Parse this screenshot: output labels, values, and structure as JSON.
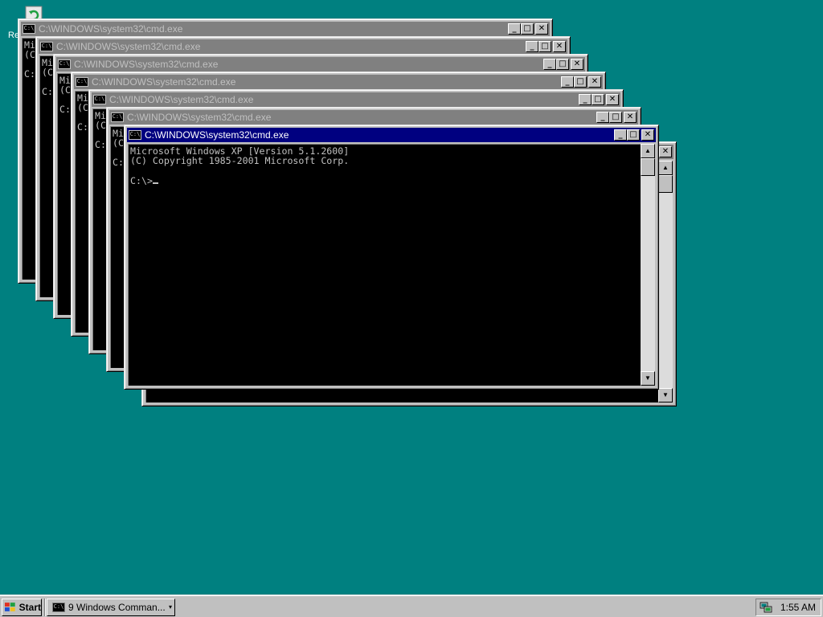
{
  "desktop": {
    "background_color": "#008080",
    "recycle_bin_label": "Re"
  },
  "console": {
    "title": "C:\\WINDOWS\\system32\\cmd.exe",
    "icon_text": "C:\\",
    "line1": "Microsoft Windows XP [Version 5.1.2600]",
    "line2": "(C) Copyright 1985-2001 Microsoft Corp.",
    "prompt": "C:\\>",
    "partial_line1": "Mi",
    "partial_line2": "(C",
    "partial_prompt": "C:",
    "minimize_symbol": "_",
    "maximize_symbol": "□",
    "close_symbol": "✕",
    "scroll_up": "▲",
    "scroll_down": "▼"
  },
  "taskbar": {
    "start_label": "Start",
    "task_label": "9 Windows Comman...",
    "task_arrow": "▾",
    "clock": "1:55 AM"
  },
  "colors": {
    "active_title": "#000080",
    "inactive_title": "#808080",
    "console_bg": "#000000",
    "console_text": "#c0c0c0"
  }
}
